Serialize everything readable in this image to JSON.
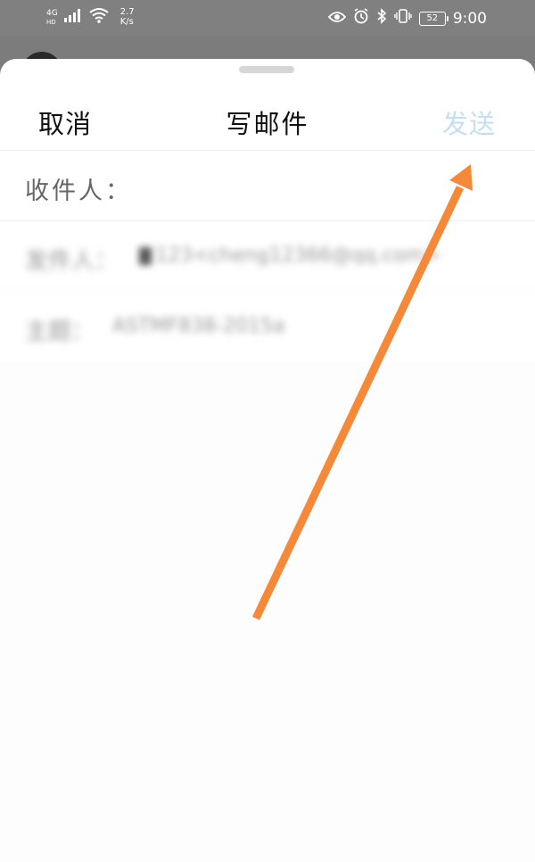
{
  "status_bar": {
    "network_type": "4G",
    "network_sub": "HD",
    "speed_value": "2.7",
    "speed_unit": "K/s",
    "battery": "52",
    "time": "9:00"
  },
  "sheet": {
    "cancel_label": "取消",
    "title": "写邮件",
    "send_label": "发送",
    "to_label": "收件人：",
    "to_value": "",
    "from_label": "发件人：",
    "from_value": "123<cheng12366@qq.com>",
    "subject_label": "主题：",
    "subject_value": "ASTMF838-2015a"
  },
  "colors": {
    "send_disabled": "#c5dff2",
    "arrow": "#f5893a"
  }
}
